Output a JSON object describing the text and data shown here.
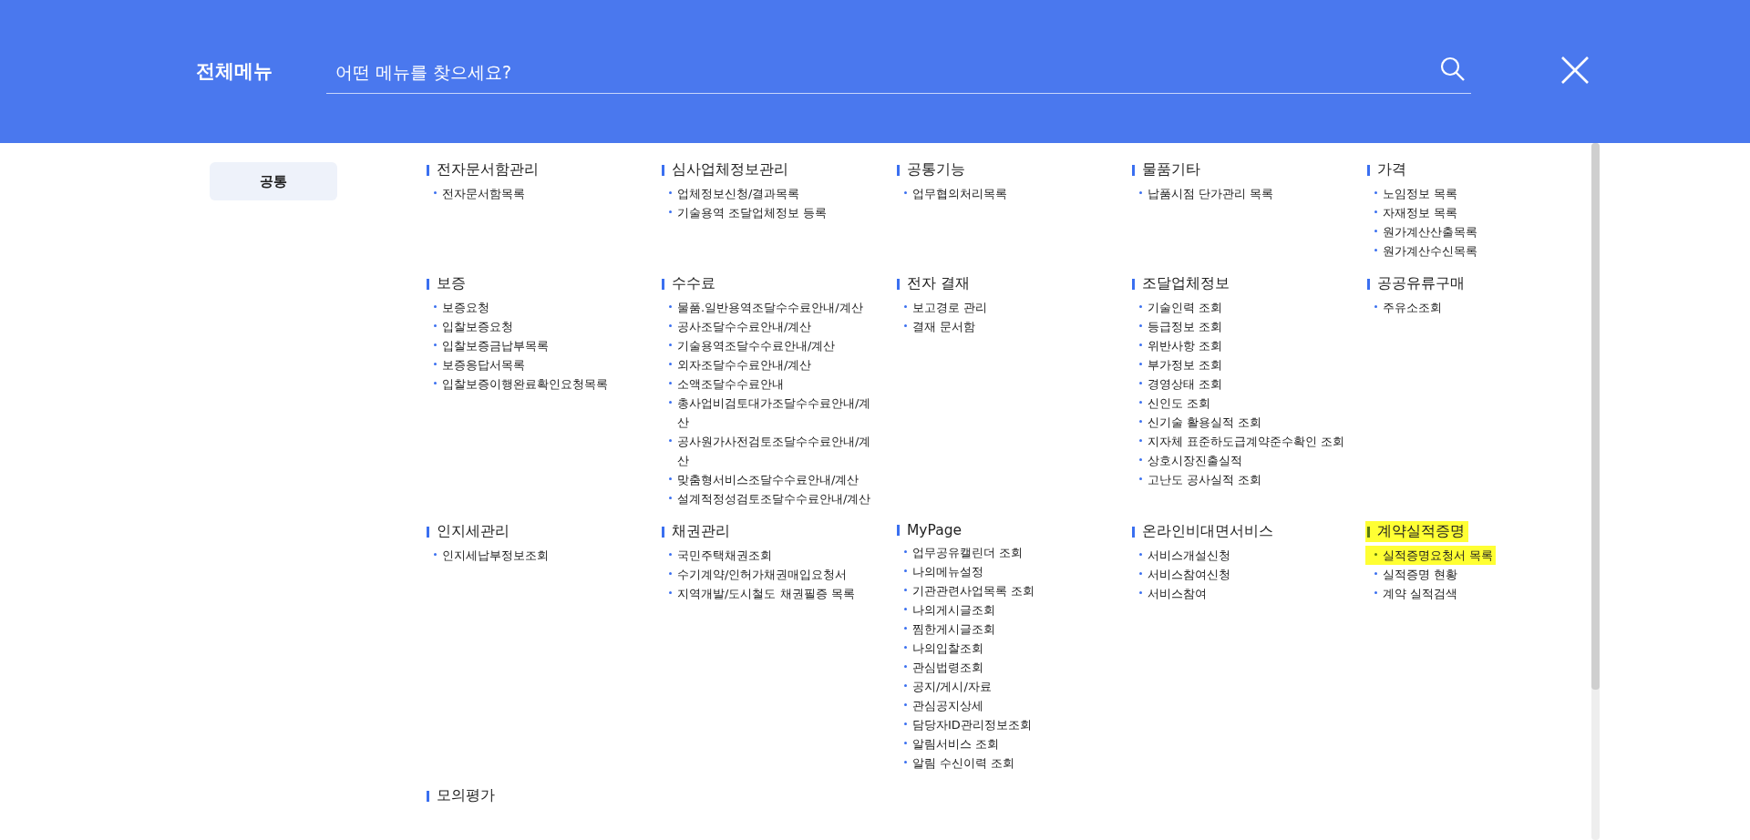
{
  "header": {
    "title": "전체메뉴",
    "search": {
      "placeholder": "어떤 메뉴를 찾으세요?"
    }
  },
  "sidebar": {
    "items": [
      {
        "label": "공통",
        "selected": true
      }
    ]
  },
  "sections": [
    {
      "title": "전자문서함관리",
      "highlighted": false,
      "items": [
        {
          "label": "전자문서함목록",
          "highlighted": false
        }
      ]
    },
    {
      "title": "심사업체정보관리",
      "highlighted": false,
      "items": [
        {
          "label": "업체정보신청/결과목록",
          "highlighted": false
        },
        {
          "label": "기술용역 조달업체정보 등록",
          "highlighted": false
        }
      ]
    },
    {
      "title": "공통기능",
      "highlighted": false,
      "items": [
        {
          "label": "업무협의처리목록",
          "highlighted": false
        }
      ]
    },
    {
      "title": "물품기타",
      "highlighted": false,
      "items": [
        {
          "label": "납품시점 단가관리 목록",
          "highlighted": false
        }
      ]
    },
    {
      "title": "가격",
      "highlighted": false,
      "items": [
        {
          "label": "노임정보 목록",
          "highlighted": false
        },
        {
          "label": "자재정보 목록",
          "highlighted": false
        },
        {
          "label": "원가계산산출목록",
          "highlighted": false
        },
        {
          "label": "원가계산수신목록",
          "highlighted": false
        }
      ]
    },
    {
      "title": "보증",
      "highlighted": false,
      "items": [
        {
          "label": "보증요청",
          "highlighted": false
        },
        {
          "label": "입찰보증요청",
          "highlighted": false
        },
        {
          "label": "입찰보증금납부목록",
          "highlighted": false
        },
        {
          "label": "보증응답서목록",
          "highlighted": false
        },
        {
          "label": "입찰보증이행완료확인요청목록",
          "highlighted": false
        }
      ]
    },
    {
      "title": "수수료",
      "highlighted": false,
      "items": [
        {
          "label": "물품.일반용역조달수수료안내/계산",
          "highlighted": false
        },
        {
          "label": "공사조달수수료안내/계산",
          "highlighted": false
        },
        {
          "label": "기술용역조달수수료안내/계산",
          "highlighted": false
        },
        {
          "label": "외자조달수수료안내/계산",
          "highlighted": false
        },
        {
          "label": "소액조달수수료안내",
          "highlighted": false
        },
        {
          "label": "총사업비검토대가조달수수료안내/계산",
          "highlighted": false
        },
        {
          "label": "공사원가사전검토조달수수료안내/계산",
          "highlighted": false
        },
        {
          "label": "맞춤형서비스조달수수료안내/계산",
          "highlighted": false
        },
        {
          "label": "설계적정성검토조달수수료안내/계산",
          "highlighted": false
        }
      ]
    },
    {
      "title": "전자 결재",
      "highlighted": false,
      "items": [
        {
          "label": "보고경로 관리",
          "highlighted": false
        },
        {
          "label": "결재 문서함",
          "highlighted": false
        }
      ]
    },
    {
      "title": "조달업체정보",
      "highlighted": false,
      "items": [
        {
          "label": "기술인력 조회",
          "highlighted": false
        },
        {
          "label": "등급정보 조회",
          "highlighted": false
        },
        {
          "label": "위반사항 조회",
          "highlighted": false
        },
        {
          "label": "부가정보 조회",
          "highlighted": false
        },
        {
          "label": "경영상태 조회",
          "highlighted": false
        },
        {
          "label": "신인도 조회",
          "highlighted": false
        },
        {
          "label": "신기술 활용실적 조회",
          "highlighted": false
        },
        {
          "label": "지자체 표준하도급계약준수확인 조회",
          "highlighted": false
        },
        {
          "label": "상호시장진출실적",
          "highlighted": false
        },
        {
          "label": "고난도 공사실적 조회",
          "highlighted": false
        }
      ]
    },
    {
      "title": "공공유류구매",
      "highlighted": false,
      "items": [
        {
          "label": "주유소조회",
          "highlighted": false
        }
      ]
    },
    {
      "title": "인지세관리",
      "highlighted": false,
      "items": [
        {
          "label": "인지세납부정보조회",
          "highlighted": false
        }
      ]
    },
    {
      "title": "채권관리",
      "highlighted": false,
      "items": [
        {
          "label": "국민주택채권조회",
          "highlighted": false
        },
        {
          "label": "수기계약/인허가채권매입요청서",
          "highlighted": false
        },
        {
          "label": "지역개발/도시철도 채권필증 목록",
          "highlighted": false
        }
      ]
    },
    {
      "title": "MyPage",
      "highlighted": false,
      "items": [
        {
          "label": "업무공유캘린더 조회",
          "highlighted": false
        },
        {
          "label": "나의메뉴설정",
          "highlighted": false
        },
        {
          "label": "기관관련사업목록 조회",
          "highlighted": false
        },
        {
          "label": "나의게시글조회",
          "highlighted": false
        },
        {
          "label": "찜한게시글조회",
          "highlighted": false
        },
        {
          "label": "나의입찰조회",
          "highlighted": false
        },
        {
          "label": "관심법령조회",
          "highlighted": false
        },
        {
          "label": "공지/게시/자료",
          "highlighted": false
        },
        {
          "label": "관심공지상세",
          "highlighted": false
        },
        {
          "label": "담당자ID관리정보조회",
          "highlighted": false
        },
        {
          "label": "알림서비스 조회",
          "highlighted": false
        },
        {
          "label": "알림 수신이력 조회",
          "highlighted": false
        }
      ]
    },
    {
      "title": "온라인비대면서비스",
      "highlighted": false,
      "items": [
        {
          "label": "서비스개설신청",
          "highlighted": false
        },
        {
          "label": "서비스참여신청",
          "highlighted": false
        },
        {
          "label": "서비스참여",
          "highlighted": false
        }
      ]
    },
    {
      "title": "계약실적증명",
      "highlighted": true,
      "items": [
        {
          "label": "실적증명요청서 목록",
          "highlighted": true
        },
        {
          "label": "실적증명 현황",
          "highlighted": false
        },
        {
          "label": "계약 실적검색",
          "highlighted": false
        }
      ]
    },
    {
      "title": "모의평가",
      "highlighted": false
    }
  ]
}
